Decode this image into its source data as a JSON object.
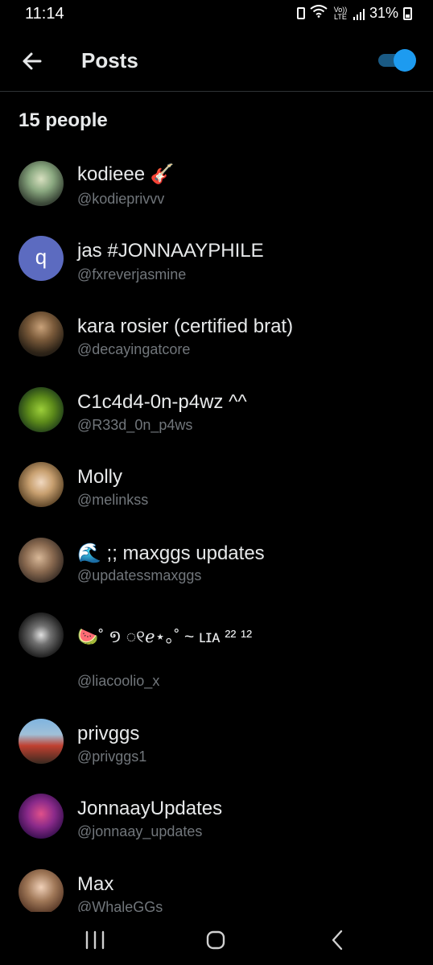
{
  "status": {
    "time": "11:14",
    "network": "Vo)) LTE",
    "battery": "31%"
  },
  "header": {
    "title": "Posts",
    "back_icon": "arrow-left-icon",
    "toggle_on": true,
    "accent": "#1d9bf0"
  },
  "people_count": "15 people",
  "people": [
    {
      "name": "kodieee 🎸",
      "handle": "@kodieprivvv",
      "avatar": "photo"
    },
    {
      "name": "jas #JONNAAYPHILE",
      "handle": "@fxreverjasmine",
      "avatar": "q",
      "avatar_color": "#5c6bc0"
    },
    {
      "name": "kara rosier (certified brat)",
      "handle": "@decayingatcore",
      "avatar": "photo"
    },
    {
      "name": "C1c4d4-0n-p4wz ^^",
      "handle": "@R33d_0n_p4ws",
      "avatar": "photo"
    },
    {
      "name": "Molly",
      "handle": "@melinkss",
      "avatar": "photo"
    },
    {
      "name": "🌊 ;; maxggs updates",
      "handle": "@updatessmaxggs",
      "avatar": "photo"
    },
    {
      "name": "🍉˚ ១ ◌୧ℯ⋆｡˚ ~ ʟɪᴀ ²² ¹²",
      "handle": "@liacoolio_x",
      "avatar": "photo"
    },
    {
      "name": "privggs",
      "handle": "@privggs1",
      "avatar": "photo"
    },
    {
      "name": "JonnaayUpdates",
      "handle": "@jonnaay_updates",
      "avatar": "photo"
    },
    {
      "name": "Max",
      "handle": "@WhaleGGs",
      "avatar": "photo"
    }
  ],
  "nav": {
    "recents_icon": "recent-apps-icon",
    "home_icon": "home-icon",
    "back_icon": "back-chevron-icon"
  }
}
